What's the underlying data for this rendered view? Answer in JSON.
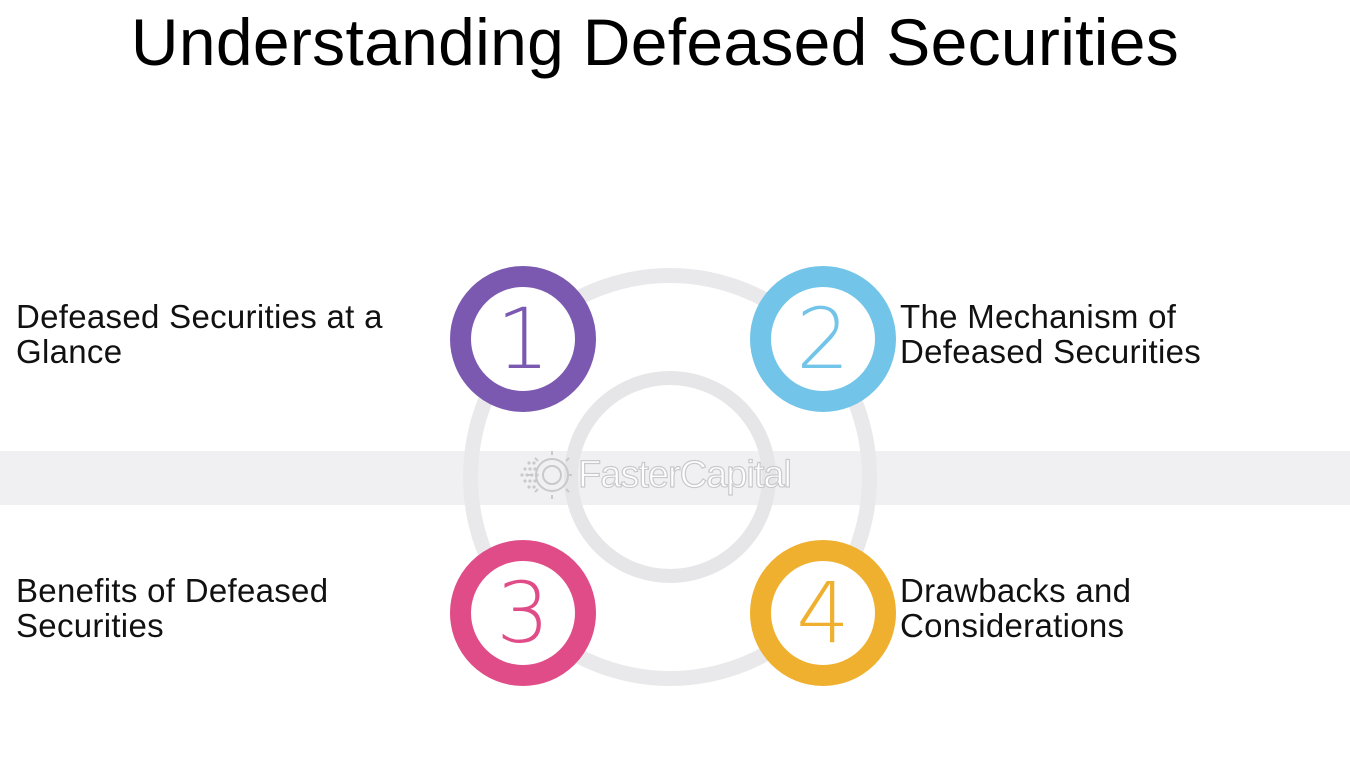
{
  "title": "Understanding Defeased Securities",
  "watermark": "FasterCapital",
  "steps": [
    {
      "number": "1",
      "label_line1": "Defeased Securities at a",
      "label_line2": "Glance",
      "color": "#7b59b0"
    },
    {
      "number": "2",
      "label_line1": "The Mechanism of",
      "label_line2": "Defeased Securities",
      "color": "#72c4e8"
    },
    {
      "number": "3",
      "label_line1": "Benefits of Defeased",
      "label_line2": "Securities",
      "color": "#e04c87"
    },
    {
      "number": "4",
      "label_line1": "Drawbacks and",
      "label_line2": "Considerations",
      "color": "#efb02f"
    }
  ],
  "colors": {
    "ring": "#e9e9eb",
    "band": "#f0eff1"
  }
}
